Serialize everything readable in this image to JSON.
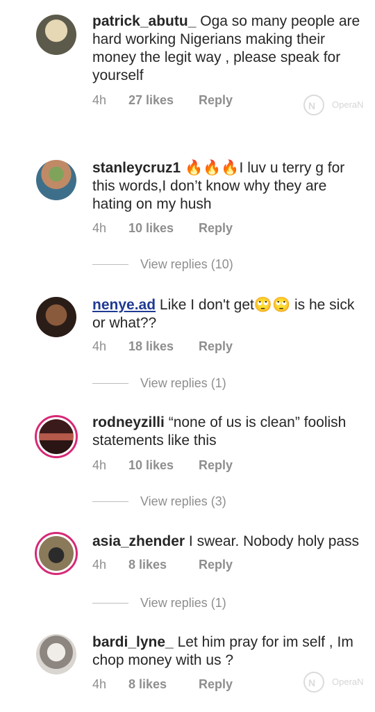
{
  "comments": [
    {
      "user": "patrick_abutu_",
      "text": "Oga so many people are hard working Nigerians making their money the legit way ,  please speak for yourself",
      "time": "4h",
      "likes": "27 likes",
      "reply": "Reply"
    },
    {
      "user": "stanleycruz1",
      "emoji": "🔥🔥🔥",
      "text": "I luv u terry g for this words,I don’t know why they are hating on my hush",
      "time": "4h",
      "likes": "10 likes",
      "reply": "Reply",
      "view_replies": "View replies (10)"
    },
    {
      "user": "nenye.ad",
      "text_a": "Like I don't get",
      "emoji": "🙄🙄",
      "text_b": " is he sick or what??",
      "time": "4h",
      "likes": "18 likes",
      "reply": "Reply",
      "view_replies": "View replies (1)"
    },
    {
      "user": "rodneyzilli",
      "text": "“none of us is clean” foolish statements like this",
      "time": "4h",
      "likes": "10 likes",
      "reply": "Reply",
      "view_replies": "View replies (3)"
    },
    {
      "user": "asia_zhender",
      "text": "I swear. Nobody holy pass",
      "time": "4h",
      "likes": "8 likes",
      "reply": "Reply",
      "view_replies": "View replies (1)"
    },
    {
      "user": "bardi_lyne_",
      "text": "Let him pray for im self , Im chop money with us ?",
      "time": "4h",
      "likes": "8 likes",
      "reply": "Reply"
    }
  ],
  "watermark": "OperaN",
  "colors": {
    "username": "#262626",
    "link": "#1f3a93",
    "meta": "#8e8e8e",
    "story_ring": "#d62976"
  }
}
